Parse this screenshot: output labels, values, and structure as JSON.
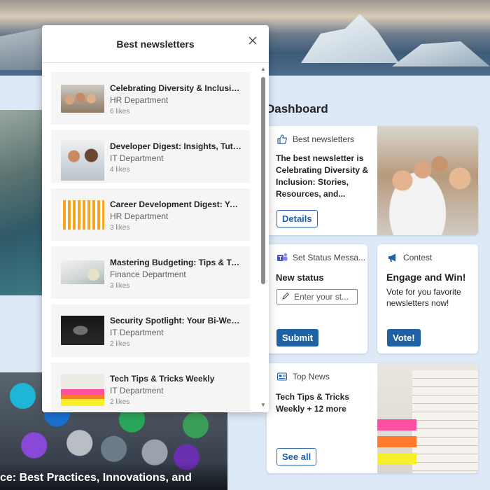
{
  "popup": {
    "title": "Best newsletters",
    "items": [
      {
        "title": "Celebrating Diversity & Inclusio...",
        "department": "HR Department",
        "likes": "6 likes"
      },
      {
        "title": "Developer Digest: Insights, Tuto...",
        "department": "IT Department",
        "likes": "4 likes"
      },
      {
        "title": "Career Development Digest: Yo...",
        "department": "HR Department",
        "likes": "3 likes"
      },
      {
        "title": "Mastering Budgeting: Tips & Tri...",
        "department": "Finance Department",
        "likes": "3 likes"
      },
      {
        "title": "Security Spotlight: Your Bi-Wee...",
        "department": "IT Department",
        "likes": "2 likes"
      },
      {
        "title": "Tech Tips & Tricks Weekly",
        "department": "IT Department",
        "likes": "2 likes"
      }
    ]
  },
  "dashboard": {
    "title": "Dashboard",
    "newsletters_card": {
      "header": "Best newsletters",
      "body": "The best newsletter is Celebrating Diversity & Inclusion: Stories, Resources, and...",
      "button": "Details"
    },
    "status_card": {
      "header": "Set Status Messa...",
      "label": "New status",
      "placeholder": "Enter your st...",
      "button": "Submit"
    },
    "contest_card": {
      "header": "Contest",
      "headline": "Engage and Win!",
      "sub": "Vote for you favorite newsletters now!",
      "button": "Vote!"
    },
    "news_card": {
      "header": "Top News",
      "body": "Tech Tips & Tricks Weekly + 12 more",
      "button": "See all"
    }
  },
  "background": {
    "hex_caption": "ce: Best Practices, Innovations, and"
  },
  "colors": {
    "accent": "#1f62a3",
    "card_bg": "#ffffff",
    "page_bg": "#dde9f7"
  }
}
